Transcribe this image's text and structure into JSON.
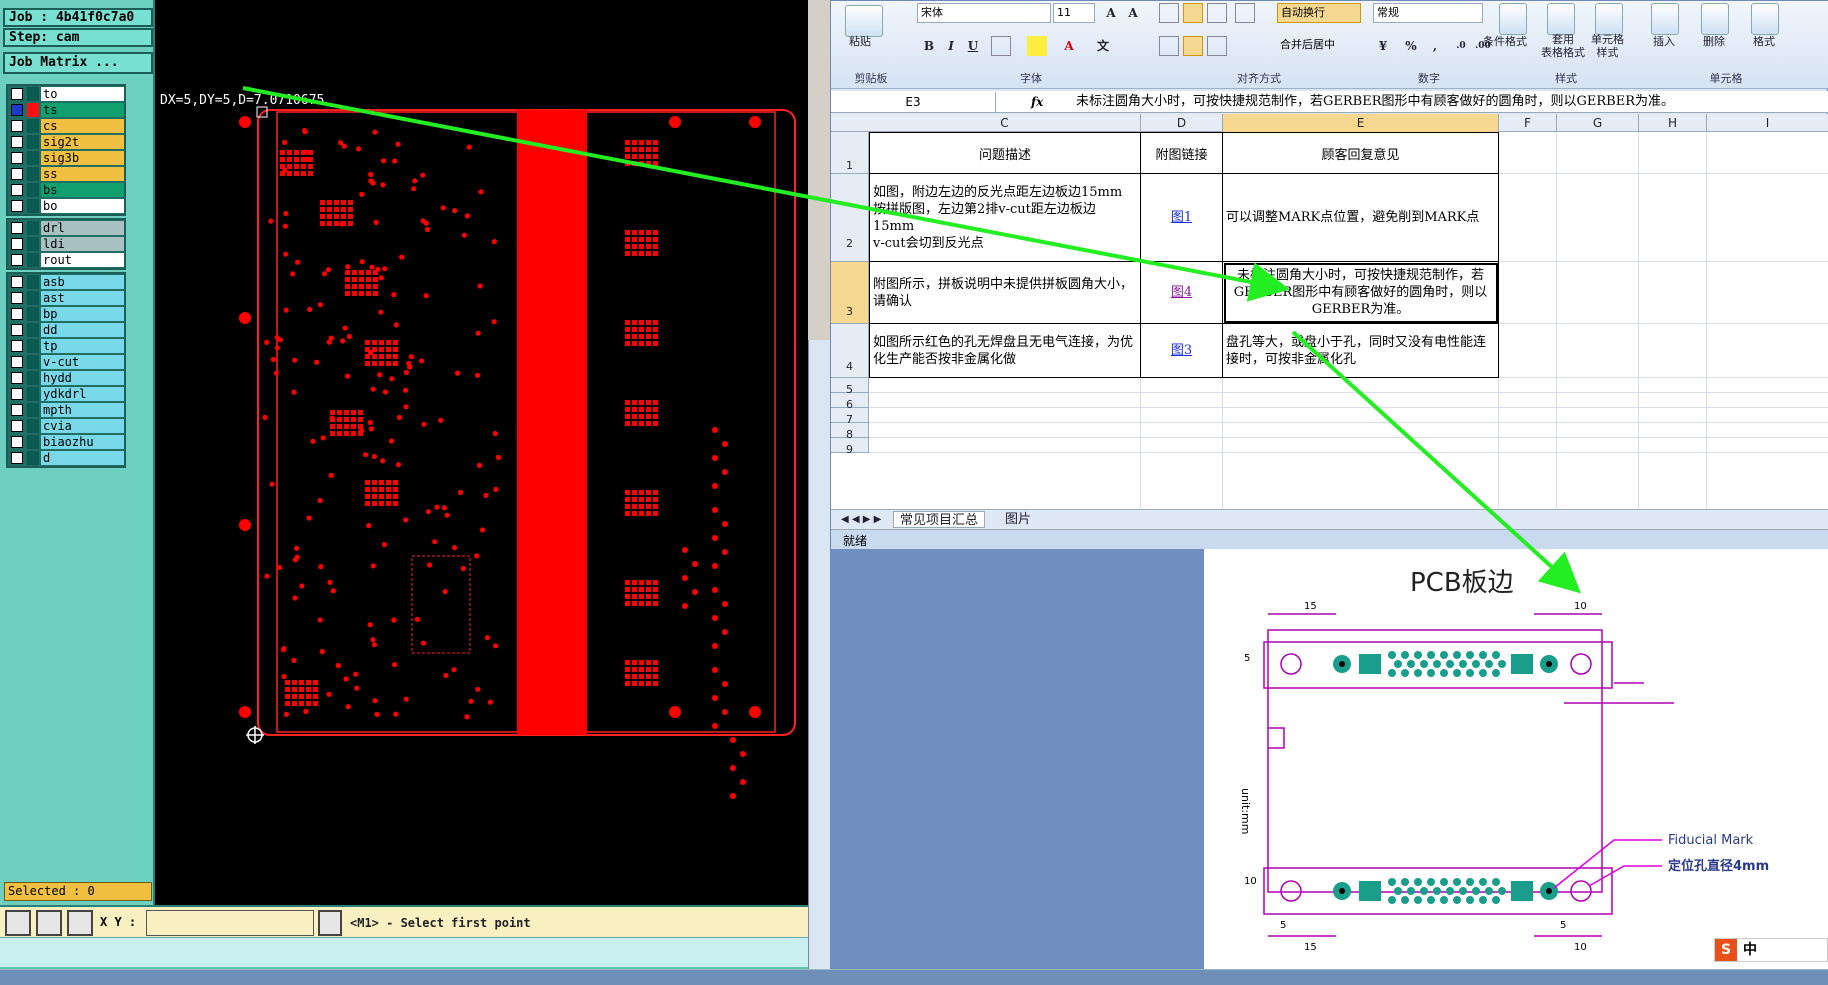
{
  "cam": {
    "job_label": "Job : 4b41f0c7a0",
    "step_label": "Step: cam",
    "matrix_button": "Job Matrix ...",
    "measure_readout": "DX=5,DY=5,D=7.0710675",
    "selected_label": "Selected : 0",
    "xy_label": "X Y :",
    "xy_value": "",
    "hint_message": "<M1> - Select first point",
    "layers_group1": [
      {
        "name": "to",
        "color": "white"
      },
      {
        "name": "ts",
        "color": "green"
      },
      {
        "name": "cs",
        "color": "orange"
      },
      {
        "name": "sig2t",
        "color": "orange"
      },
      {
        "name": "sig3b",
        "color": "orange"
      },
      {
        "name": "ss",
        "color": "orange"
      },
      {
        "name": "bs",
        "color": "green"
      },
      {
        "name": "bo",
        "color": "white"
      }
    ],
    "layers_group2": [
      {
        "name": "drl",
        "color": "gray"
      },
      {
        "name": "ldi",
        "color": "gray"
      },
      {
        "name": "rout",
        "color": "white"
      }
    ],
    "layers_group3": [
      {
        "name": "asb"
      },
      {
        "name": "ast"
      },
      {
        "name": "bp"
      },
      {
        "name": "dd"
      },
      {
        "name": "tp"
      },
      {
        "name": "v-cut"
      },
      {
        "name": "hydd"
      },
      {
        "name": "ydkdrl"
      },
      {
        "name": "mpth"
      },
      {
        "name": "cvia"
      },
      {
        "name": "biaozhu"
      },
      {
        "name": "d"
      }
    ]
  },
  "excel": {
    "ribbon": {
      "paste_label": "粘贴",
      "font_name": "宋体",
      "font_size": "11",
      "wrap_text": "自动换行",
      "merge_center": "合并后居中",
      "number_format": "常规",
      "cond_format": "条件格式",
      "table_format": "套用\n表格格式",
      "cell_style": "单元格\n样式",
      "insert": "插入",
      "delete": "删除",
      "format": "格式",
      "groups": [
        "剪贴板",
        "字体",
        "对齐方式",
        "数字",
        "样式",
        "单元格"
      ]
    },
    "name_box": "E3",
    "formula_fx": "fx",
    "formula_content": "未标注圆角大小时，可按快捷规范制作，若GERBER图形中有顾客做好的圆角时，则以GERBER为准。",
    "columns": [
      "C",
      "D",
      "E",
      "F",
      "G",
      "H",
      "I"
    ],
    "rows": [
      "1",
      "2",
      "3",
      "4",
      "5",
      "6",
      "7",
      "8",
      "9"
    ],
    "table": {
      "headers": [
        "问题描述",
        "附图链接",
        "顾客回复意见"
      ],
      "rows": [
        {
          "desc": "如图，附边左边的反光点距左边板边15mm\n按拼版图，左边第2排v-cut距左边板边15mm\nv-cut会切到反光点",
          "link": "图1",
          "reply": "可以调整MARK点位置，避免削到MARK点"
        },
        {
          "desc": "附图所示，拼板说明中未提供拼板圆角大小，请确认",
          "link": "图4",
          "reply": "未标注圆角大小时，可按快捷规范制作，若GERBER图形中有顾客做好的圆角时，则以GERBER为准。"
        },
        {
          "desc": "如图所示红色的孔无焊盘且无电气连接，为优化生产能否按非金属化做",
          "link": "图3",
          "reply": "盘孔等大，或盘小于孔，同时又没有电性能连接时，可按非金属化孔"
        }
      ]
    },
    "sheet_tabs": [
      "常见项目汇总",
      "图片"
    ],
    "status": "就绪"
  },
  "doc": {
    "title": "PCB板边",
    "fiducial_label": "Fiducial Mark",
    "hole_label": "定位孔直径4mm",
    "unit_label": "unit:mm",
    "dims": [
      "15",
      "10",
      "5",
      "10",
      "5",
      "15",
      "10",
      "5"
    ],
    "ime_label": "中"
  },
  "colors": {
    "arrow": "#22ee22",
    "pcb_red": "#ff0000",
    "cam_panel": "#6ccfbf",
    "magenta_dim": "#b000b0",
    "pad_green": "#1a9e8c"
  }
}
